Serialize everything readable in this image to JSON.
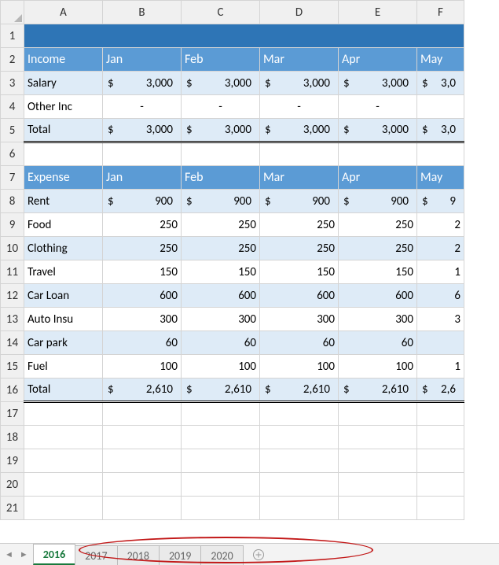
{
  "columns": [
    "A",
    "B",
    "C",
    "D",
    "E",
    "F"
  ],
  "rows": [
    "1",
    "2",
    "3",
    "4",
    "5",
    "6",
    "7",
    "8",
    "9",
    "10",
    "11",
    "12",
    "13",
    "14",
    "15",
    "16",
    "17",
    "18",
    "19",
    "20",
    "21"
  ],
  "income": {
    "label": "Income",
    "months": [
      "Jan",
      "Feb",
      "Mar",
      "Apr",
      "May"
    ],
    "rows": [
      {
        "label": "Salary",
        "currency": "$",
        "values": [
          "3,000",
          "3,000",
          "3,000",
          "3,000",
          "3,0"
        ]
      },
      {
        "label": "Other Inc",
        "currency": "",
        "values": [
          "-",
          "-",
          "-",
          "-",
          ""
        ]
      }
    ],
    "total": {
      "label": "Total",
      "currency": "$",
      "values": [
        "3,000",
        "3,000",
        "3,000",
        "3,000",
        "3,0"
      ]
    }
  },
  "expense": {
    "label": "Expense",
    "months": [
      "Jan",
      "Feb",
      "Mar",
      "Apr",
      "May"
    ],
    "rows": [
      {
        "label": "Rent",
        "currency": "$",
        "values": [
          "900",
          "900",
          "900",
          "900",
          "9"
        ]
      },
      {
        "label": "Food",
        "values": [
          "250",
          "250",
          "250",
          "250",
          "2"
        ]
      },
      {
        "label": "Clothing",
        "values": [
          "250",
          "250",
          "250",
          "250",
          "2"
        ]
      },
      {
        "label": "Travel",
        "values": [
          "150",
          "150",
          "150",
          "150",
          "1"
        ]
      },
      {
        "label": "Car Loan",
        "values": [
          "600",
          "600",
          "600",
          "600",
          "6"
        ]
      },
      {
        "label": "Auto Insu",
        "values": [
          "300",
          "300",
          "300",
          "300",
          "3"
        ]
      },
      {
        "label": "Car park",
        "values": [
          "60",
          "60",
          "60",
          "60",
          ""
        ]
      },
      {
        "label": "Fuel",
        "values": [
          "100",
          "100",
          "100",
          "100",
          "1"
        ]
      }
    ],
    "total": {
      "label": "Total",
      "currency": "$",
      "values": [
        "2,610",
        "2,610",
        "2,610",
        "2,610",
        "2,6"
      ]
    }
  },
  "tabs": [
    "2016",
    "2017",
    "2018",
    "2019",
    "2020"
  ],
  "activeTab": "2016",
  "nav": {
    "prev": "◄",
    "next": "►"
  }
}
